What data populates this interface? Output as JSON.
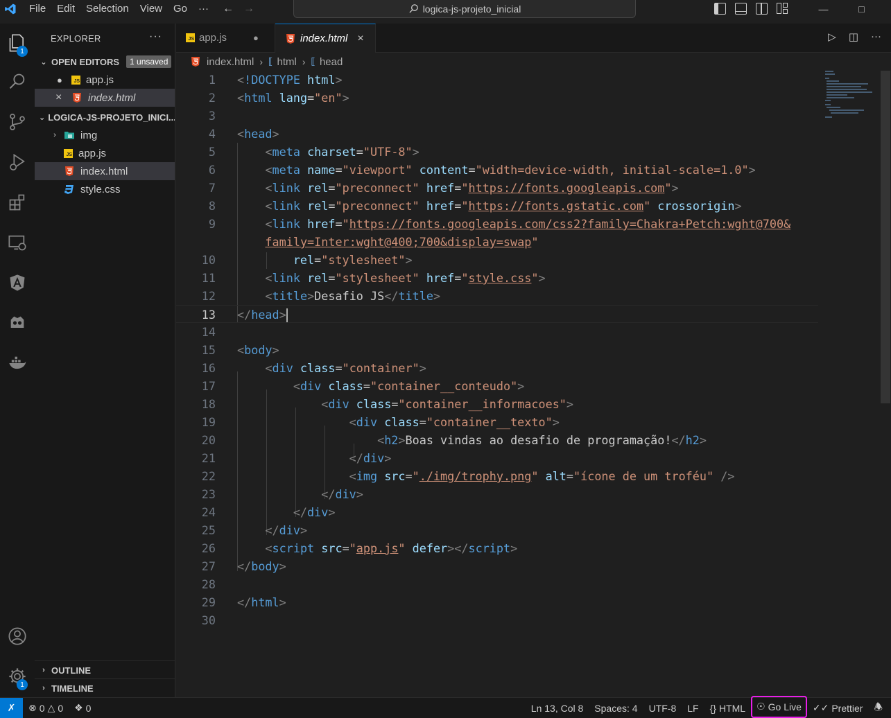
{
  "titlebar": {
    "menu": [
      "File",
      "Edit",
      "Selection",
      "View",
      "Go",
      "···"
    ],
    "search": "logica-js-projeto_inicial"
  },
  "activity": {
    "explorer_badge": "1",
    "settings_badge": "1"
  },
  "sidebar": {
    "title": "EXPLORER",
    "more": "···",
    "open_editors": {
      "label": "OPEN EDITORS",
      "badge": "1 unsaved",
      "items": [
        {
          "name": "app.js",
          "marker": "●"
        },
        {
          "name": "index.html",
          "marker": "×"
        }
      ]
    },
    "project": {
      "label": "LOGICA-JS-PROJETO_INICI...",
      "items": [
        "img",
        "app.js",
        "index.html",
        "style.css"
      ]
    },
    "outline": "OUTLINE",
    "timeline": "TIMELINE"
  },
  "tabs": [
    {
      "label": "app.js",
      "state": "●"
    },
    {
      "label": "index.html",
      "state": "×"
    }
  ],
  "breadcrumb": [
    "index.html",
    "html",
    "head"
  ],
  "editor": {
    "current_line": 13,
    "lines": [
      {
        "n": "1"
      },
      {
        "n": "2"
      },
      {
        "n": "3"
      },
      {
        "n": "4"
      },
      {
        "n": "5"
      },
      {
        "n": "6"
      },
      {
        "n": "7"
      },
      {
        "n": "8"
      },
      {
        "n": "9"
      },
      {
        "n": ""
      },
      {
        "n": "10"
      },
      {
        "n": "11"
      },
      {
        "n": "12"
      },
      {
        "n": "13"
      },
      {
        "n": "14"
      },
      {
        "n": "15"
      },
      {
        "n": "16"
      },
      {
        "n": "17"
      },
      {
        "n": "18"
      },
      {
        "n": "19"
      },
      {
        "n": "20"
      },
      {
        "n": "21"
      },
      {
        "n": "22"
      },
      {
        "n": "23"
      },
      {
        "n": "24"
      },
      {
        "n": "25"
      },
      {
        "n": "26"
      },
      {
        "n": "27"
      },
      {
        "n": "28"
      },
      {
        "n": "29"
      },
      {
        "n": "30"
      }
    ],
    "text": {
      "doctype_kw": "!DOCTYPE",
      "html": "html",
      "lang": "lang",
      "en": "\"en\"",
      "head": "head",
      "meta": "meta",
      "charset": "charset",
      "utf8": "\"UTF-8\"",
      "name": "name",
      "viewport": "\"viewport\"",
      "content": "content",
      "viewport_val": "\"width=device-width, initial-scale=1.0\"",
      "link": "link",
      "rel": "rel",
      "preconnect": "\"preconnect\"",
      "href": "href",
      "q": "\"",
      "url1": "https://fonts.googleapis.com",
      "url2": "https://fonts.gstatic.com",
      "crossorigin": "crossorigin",
      "url3a": "https://fonts.googleapis.com/css2?family=Chakra+Petch:wght@700&",
      "url3b": "family=Inter:wght@400;700&display=swap",
      "stylesheet": "\"stylesheet\"",
      "stylecss": "style.css",
      "title": "title",
      "title_text": "Desafio JS",
      "body": "body",
      "div": "div",
      "class": "class",
      "c_container": "\"container\"",
      "c_conteudo": "\"container__conteudo\"",
      "c_informacoes": "\"container__informacoes\"",
      "c_texto": "\"container__texto\"",
      "h2": "h2",
      "h2_text": "Boas vindas ao desafio de programação!",
      "img": "img",
      "src": "src",
      "img_src": "./img/trophy.png",
      "alt": "alt",
      "alt_val": "\"ícone de um troféu\"",
      "script": "script",
      "appjs": "app.js",
      "defer": "defer"
    }
  },
  "statusbar": {
    "errors": "0",
    "warnings": "0",
    "ports": "0",
    "position": "Ln 13, Col 8",
    "spaces": "Spaces: 4",
    "encoding": "UTF-8",
    "eol": "LF",
    "language": "HTML",
    "golive": "Go Live",
    "prettier": "Prettier"
  },
  "colors": {
    "accent": "#0078d4",
    "highlight": "#e81ee8"
  }
}
